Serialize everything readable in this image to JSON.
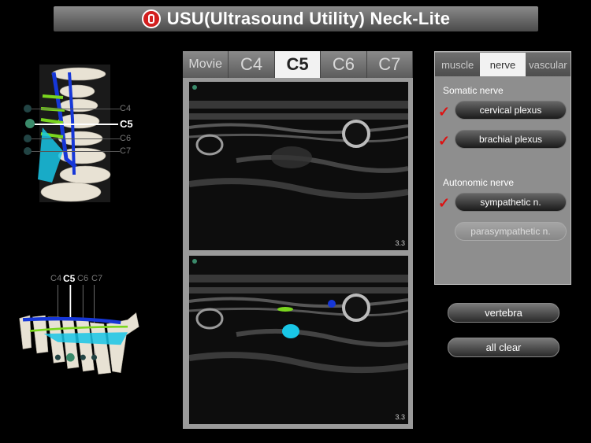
{
  "header": {
    "title": "USU(Ultrasound Utility) Neck-Lite",
    "logo_icon": "usu-logo-icon"
  },
  "spine_levels_top": {
    "c4": "C4",
    "c5": "C5",
    "c6": "C6",
    "c7": "C7",
    "selected": "C5"
  },
  "spine_levels_side": {
    "c4": "C4",
    "c5": "C5",
    "c6": "C6",
    "c7": "C7"
  },
  "level_tabs": [
    {
      "label": "Movie",
      "active": false
    },
    {
      "label": "C4",
      "active": false
    },
    {
      "label": "C5",
      "active": true
    },
    {
      "label": "C6",
      "active": false
    },
    {
      "label": "C7",
      "active": false
    }
  ],
  "ultrasound": {
    "top_scale": "3.3",
    "bottom_scale": "3.3"
  },
  "structure_tabs": [
    {
      "label": "muscle",
      "active": false
    },
    {
      "label": "nerve",
      "active": true
    },
    {
      "label": "vascular",
      "active": false
    }
  ],
  "nerve_panel": {
    "somatic_heading": "Somatic nerve",
    "cervical_plexus": "cervical plexus",
    "brachial_plexus": "brachial plexus",
    "autonomic_heading": "Autonomic nerve",
    "sympathetic": "sympathetic n.",
    "parasympathetic": "parasympathetic n.",
    "check_mark": "✓"
  },
  "actions": {
    "vertebra": "vertebra",
    "all_clear": "all clear"
  },
  "colors": {
    "nerve_green": "#7ad61e",
    "artery_blue": "#1637d8",
    "plexus_cyan": "#19c6e6",
    "check_red": "#d11"
  }
}
